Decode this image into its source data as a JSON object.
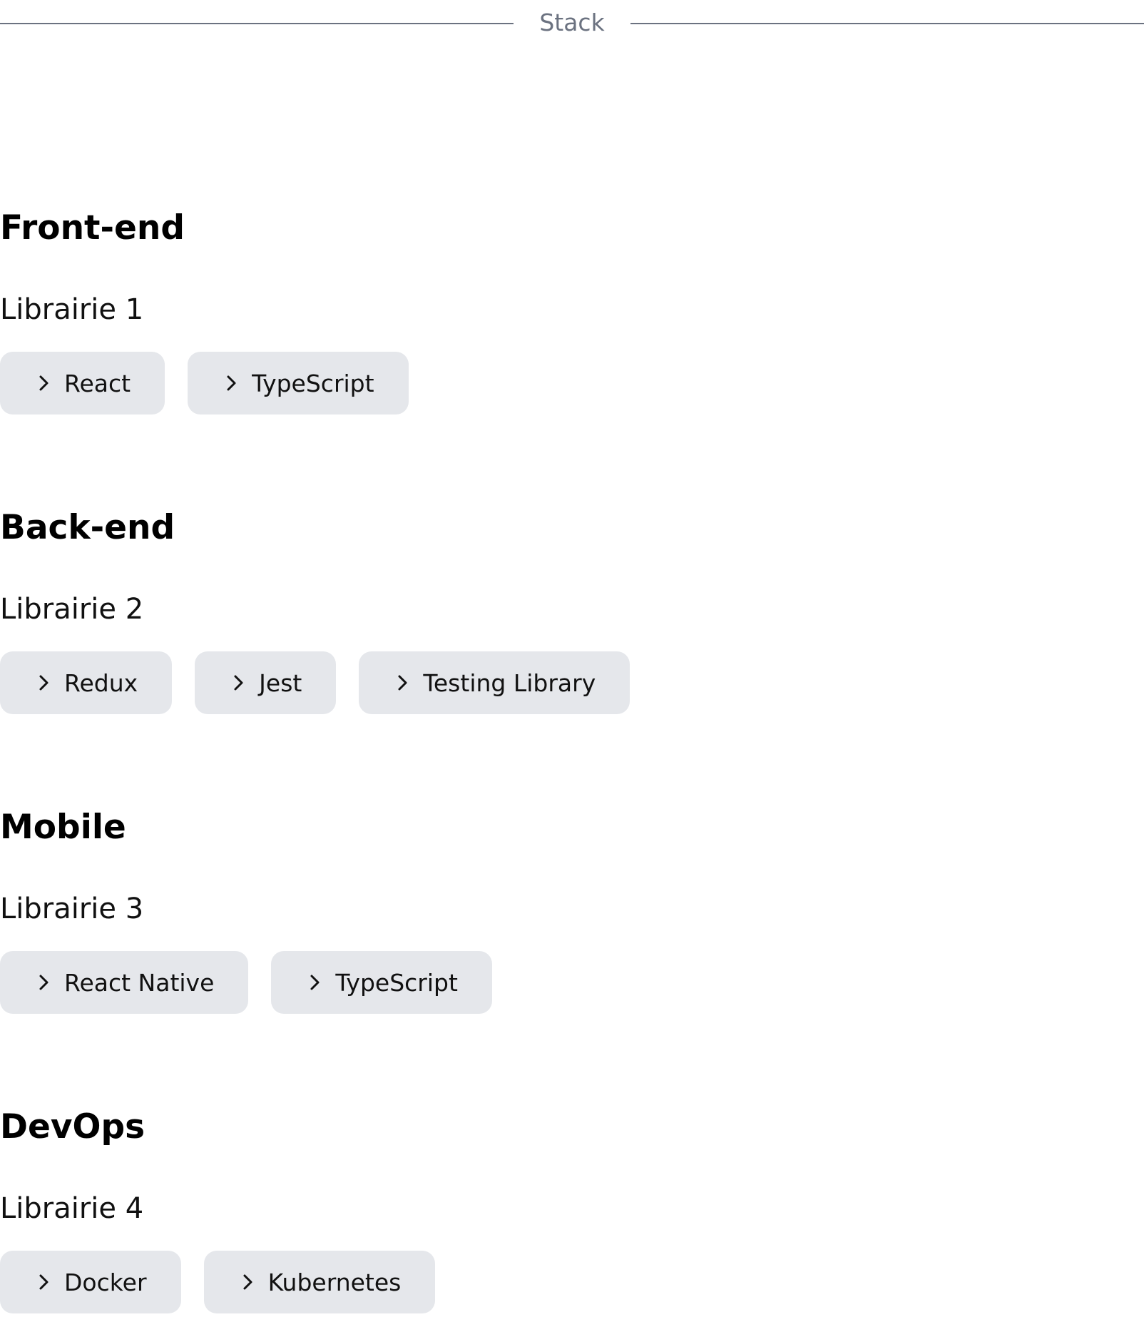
{
  "divider": {
    "label": "Stack"
  },
  "sections": [
    {
      "title": "Front-end",
      "subtitle": "Librairie 1",
      "items": [
        {
          "label": "React",
          "icon": "chevron-right-icon"
        },
        {
          "label": "TypeScript",
          "icon": "chevron-right-icon"
        }
      ]
    },
    {
      "title": "Back-end",
      "subtitle": "Librairie 2",
      "items": [
        {
          "label": "Redux",
          "icon": "chevron-right-icon"
        },
        {
          "label": "Jest",
          "icon": "chevron-right-icon"
        },
        {
          "label": "Testing Library",
          "icon": "chevron-right-icon"
        }
      ]
    },
    {
      "title": "Mobile",
      "subtitle": "Librairie 3",
      "items": [
        {
          "label": "React Native",
          "icon": "chevron-right-icon"
        },
        {
          "label": "TypeScript",
          "icon": "chevron-right-icon"
        }
      ]
    },
    {
      "title": "DevOps",
      "subtitle": "Librairie 4",
      "items": [
        {
          "label": "Docker",
          "icon": "chevron-right-icon"
        },
        {
          "label": "Kubernetes",
          "icon": "chevron-right-icon"
        }
      ]
    }
  ],
  "colors": {
    "chip_background": "#e5e7eb",
    "divider": "#6b7280",
    "heading": "#000000"
  }
}
